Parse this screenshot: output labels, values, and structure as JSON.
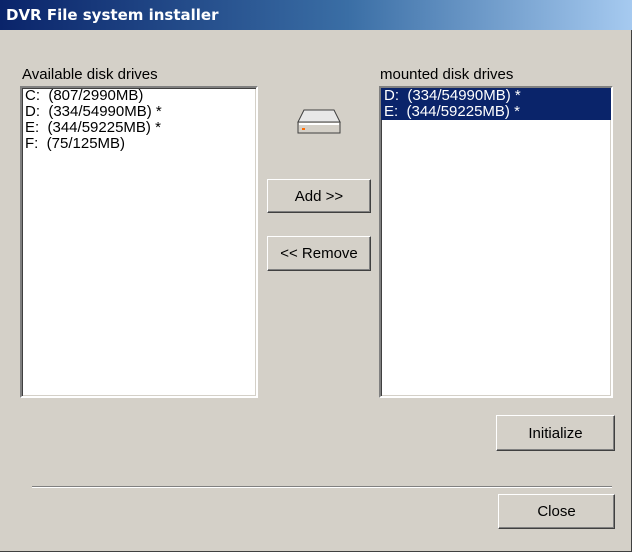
{
  "window": {
    "title": "DVR File system installer"
  },
  "available": {
    "label": "Available disk drives",
    "items": [
      "C:  (807/2990MB)",
      "D:  (334/54990MB) *",
      "E:  (344/59225MB) *",
      "F:  (75/125MB)"
    ]
  },
  "mounted": {
    "label": "mounted disk drives",
    "items": [
      "D:  (334/54990MB) *",
      "E:  (344/59225MB) *"
    ]
  },
  "buttons": {
    "add": "Add >>",
    "remove": "<< Remove",
    "initialize": "Initialize",
    "close": "Close"
  },
  "icons": {
    "drive": "hard-drive-icon"
  },
  "colors": {
    "selection": "#0a246a",
    "title_start": "#0a246a",
    "title_end": "#a6caf0"
  }
}
